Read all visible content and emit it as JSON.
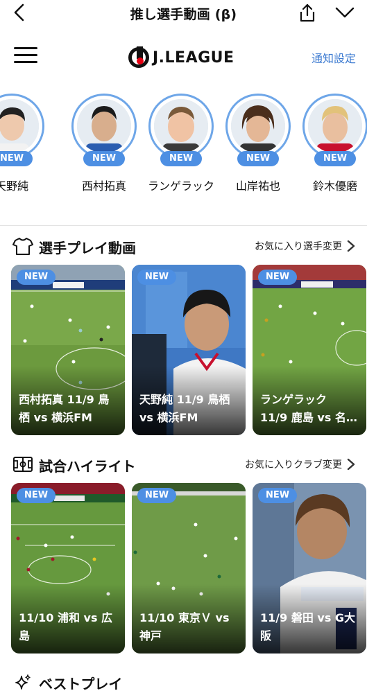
{
  "topbar": {
    "title": "推し選手動画 (β)",
    "back_icon": "chevron-left-icon",
    "share_icon": "share-icon",
    "collapse_icon": "chevron-down-icon"
  },
  "header": {
    "logo_text": "J.LEAGUE",
    "notify_label": "通知設定",
    "menu_icon": "hamburger-menu-icon"
  },
  "players": [
    {
      "name": "天野純",
      "badge": "NEW"
    },
    {
      "name": "西村拓真",
      "badge": "NEW"
    },
    {
      "name": "ランゲラック",
      "badge": "NEW"
    },
    {
      "name": "山岸祐也",
      "badge": "NEW"
    },
    {
      "name": "鈴木優磨",
      "badge": "NEW"
    }
  ],
  "player_section": {
    "title": "選手プレイ動画",
    "link": "お気に入り選手変更",
    "icon": "jersey-icon",
    "cards": [
      {
        "badge": "NEW",
        "caption": "西村拓真 11/9 鳥\n栖 vs 横浜FM"
      },
      {
        "badge": "NEW",
        "caption": "天野純 11/9 鳥栖\nvs 横浜FM"
      },
      {
        "badge": "NEW",
        "caption": "ランゲラック\n11/9 鹿島 vs 名…"
      }
    ]
  },
  "highlight_section": {
    "title": "試合ハイライト",
    "link": "お気に入りクラブ変更",
    "icon": "pitch-icon",
    "cards": [
      {
        "badge": "NEW",
        "caption": "11/10 浦和 vs 広\n島"
      },
      {
        "badge": "NEW",
        "caption": "11/10 東京Ｖ vs\n神戸"
      },
      {
        "badge": "NEW",
        "caption": "11/9 磐田 vs G大\n阪"
      }
    ]
  },
  "best_section": {
    "title": "ベストプレイ",
    "icon": "sparkle-icon"
  },
  "colors": {
    "accent": "#4d8fe3",
    "link": "#3d7bd1",
    "ring": "#6ea6e8",
    "logo_red": "#e60012"
  }
}
